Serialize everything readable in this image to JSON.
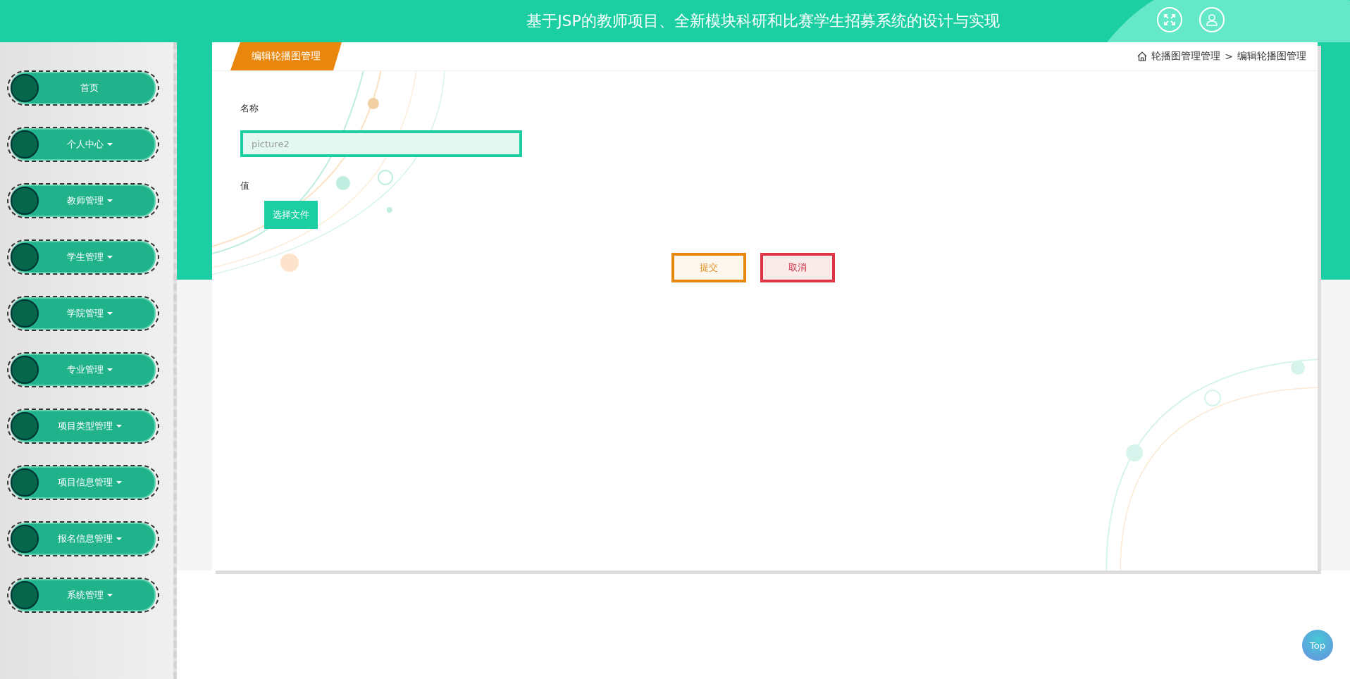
{
  "header": {
    "title": "基于JSP的教师项目、全新模块科研和比赛学生招募系统的设计与实现"
  },
  "sidebar": {
    "items": [
      {
        "label": "首页",
        "dropdown": false
      },
      {
        "label": "个人中心",
        "dropdown": true
      },
      {
        "label": "教师管理",
        "dropdown": true
      },
      {
        "label": "学生管理",
        "dropdown": true
      },
      {
        "label": "学院管理",
        "dropdown": true
      },
      {
        "label": "专业管理",
        "dropdown": true
      },
      {
        "label": "项目类型管理",
        "dropdown": true
      },
      {
        "label": "项目信息管理",
        "dropdown": true
      },
      {
        "label": "报名信息管理",
        "dropdown": true
      },
      {
        "label": "系统管理",
        "dropdown": true
      }
    ]
  },
  "page_tab": "编辑轮播图管理",
  "breadcrumb": [
    "轮播图管理管理",
    "编辑轮播图管理"
  ],
  "breadcrumb_separator": ">",
  "form": {
    "fields": [
      {
        "kind": "text",
        "label": "名称",
        "value": "picture2"
      },
      {
        "kind": "file",
        "label": "值",
        "button": "选择文件"
      }
    ]
  },
  "buttons": [
    {
      "kind": "submit",
      "label": "提交"
    },
    {
      "kind": "cancel",
      "label": "取消"
    }
  ],
  "top_button": "Top"
}
